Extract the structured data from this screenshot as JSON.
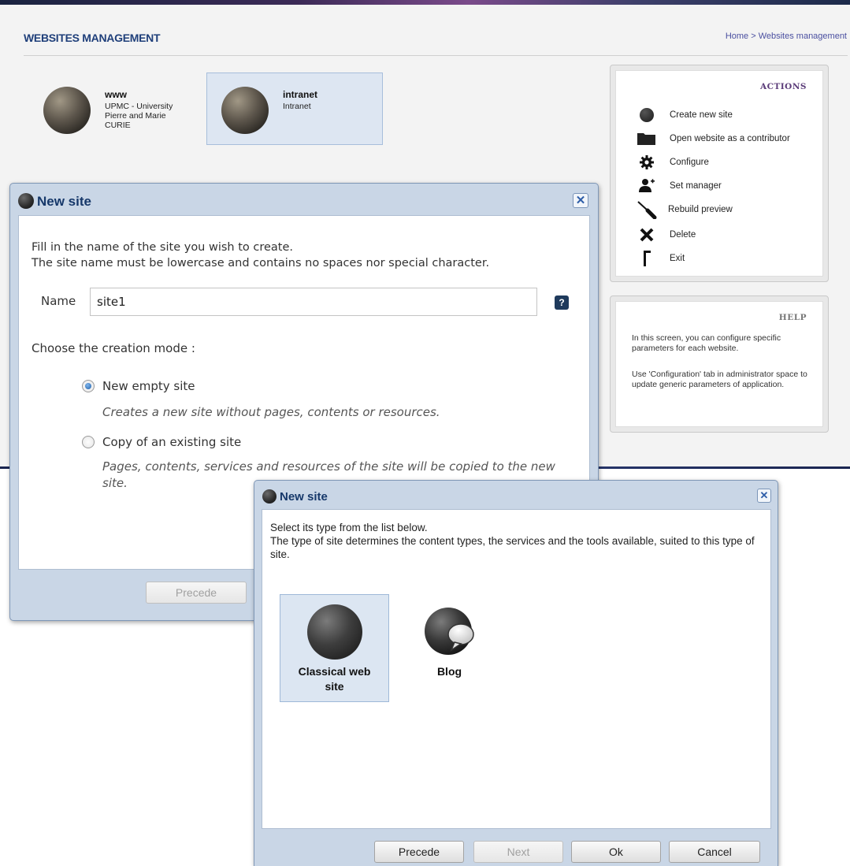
{
  "app": {
    "title": "WEBSITES MANAGEMENT",
    "breadcrumb": "Home > Websites management",
    "sites": [
      {
        "name": "www",
        "description": "UPMC - University Pierre and Marie CURIE"
      },
      {
        "name": "intranet",
        "description": "Intranet"
      }
    ],
    "actions": {
      "title": "ACTIONS",
      "items": [
        {
          "label": "Create new site",
          "icon": "globe-icon"
        },
        {
          "label": "Open website as a contributor",
          "icon": "folder-icon"
        },
        {
          "label": "Configure",
          "icon": "gear-icon"
        },
        {
          "label": "Set manager",
          "icon": "add-user-icon"
        },
        {
          "label": "Rebuild preview",
          "icon": "screwdriver-icon"
        },
        {
          "label": "Delete",
          "icon": "cross-icon"
        },
        {
          "label": "Exit",
          "icon": "exit-icon"
        }
      ]
    },
    "help": {
      "title": "HELP",
      "paragraphs": [
        "In this screen, you can configure specific parameters for each website.",
        "Use 'Configuration' tab in administrator space to update generic parameters of application."
      ]
    }
  },
  "dialog_name": {
    "title": "New site",
    "intro_line1": "Fill in the name of the site you wish to create.",
    "intro_line2": "The site name must be lowercase and contains no spaces nor special character.",
    "name_label": "Name",
    "name_value": "site1",
    "help_button": "?",
    "mode_label": "Choose the creation mode :",
    "options": [
      {
        "label": "New empty site",
        "description": "Creates a new site without pages, contents or resources.",
        "checked": true
      },
      {
        "label": "Copy of an existing site",
        "description": "Pages, contents, services and resources of the site will be copied to the new site.",
        "checked": false
      }
    ],
    "buttons": {
      "precede": "Precede"
    }
  },
  "dialog_type": {
    "title": "New site",
    "intro_line1": "Select its type from the list below.",
    "intro_line2": "The type of site determines the content types, the services and the tools available, suited to this type of site.",
    "types": [
      {
        "label": "Classical web site",
        "icon": "globe-icon",
        "selected": true
      },
      {
        "label": "Blog",
        "icon": "blog-icon",
        "selected": false
      }
    ],
    "buttons": {
      "precede": "Precede",
      "next": "Next",
      "ok": "Ok",
      "cancel": "Cancel"
    }
  }
}
